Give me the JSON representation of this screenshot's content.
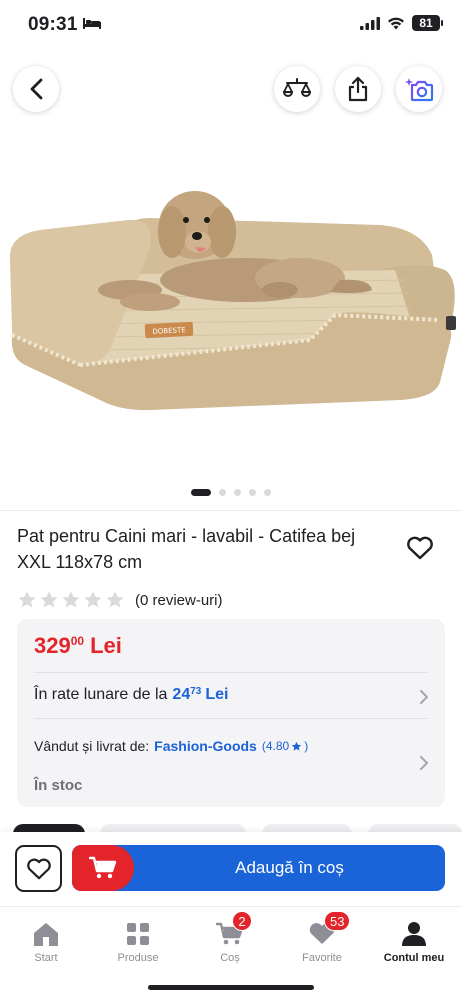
{
  "status": {
    "time": "09:31",
    "battery": "81"
  },
  "product": {
    "title": "Pat pentru Caini mari - lavabil - Catifea bej XXL 118x78 cm",
    "brand_label": "DOBESTE",
    "rating": 0,
    "reviews": "(0 review-uri)",
    "image_count": 5,
    "active_image": 1
  },
  "price": {
    "main": "329",
    "cents": "00",
    "currency": "Lei"
  },
  "installments": {
    "prefix": "În rate lunare de la",
    "amount": "24",
    "cents": "73",
    "currency": "Lei"
  },
  "seller": {
    "prefix": "Vândut și livrat de:",
    "name": "Fashion-Goods",
    "rating": "(4.80",
    "rating_suffix": ")"
  },
  "stock": "În stoc",
  "actions": {
    "add_to_cart": "Adaugă în coș"
  },
  "tabs": [
    {
      "label": "Start",
      "icon": "home-icon"
    },
    {
      "label": "Produse",
      "icon": "grid-icon"
    },
    {
      "label": "Coș",
      "icon": "cart-icon",
      "badge": "2"
    },
    {
      "label": "Favorite",
      "icon": "heart-icon",
      "badge": "53"
    },
    {
      "label": "Contul meu",
      "icon": "user-icon"
    }
  ],
  "colors": {
    "accent_red": "#e3242b",
    "accent_blue": "#1b63d8",
    "bed_fabric": "#d9c4a2"
  }
}
